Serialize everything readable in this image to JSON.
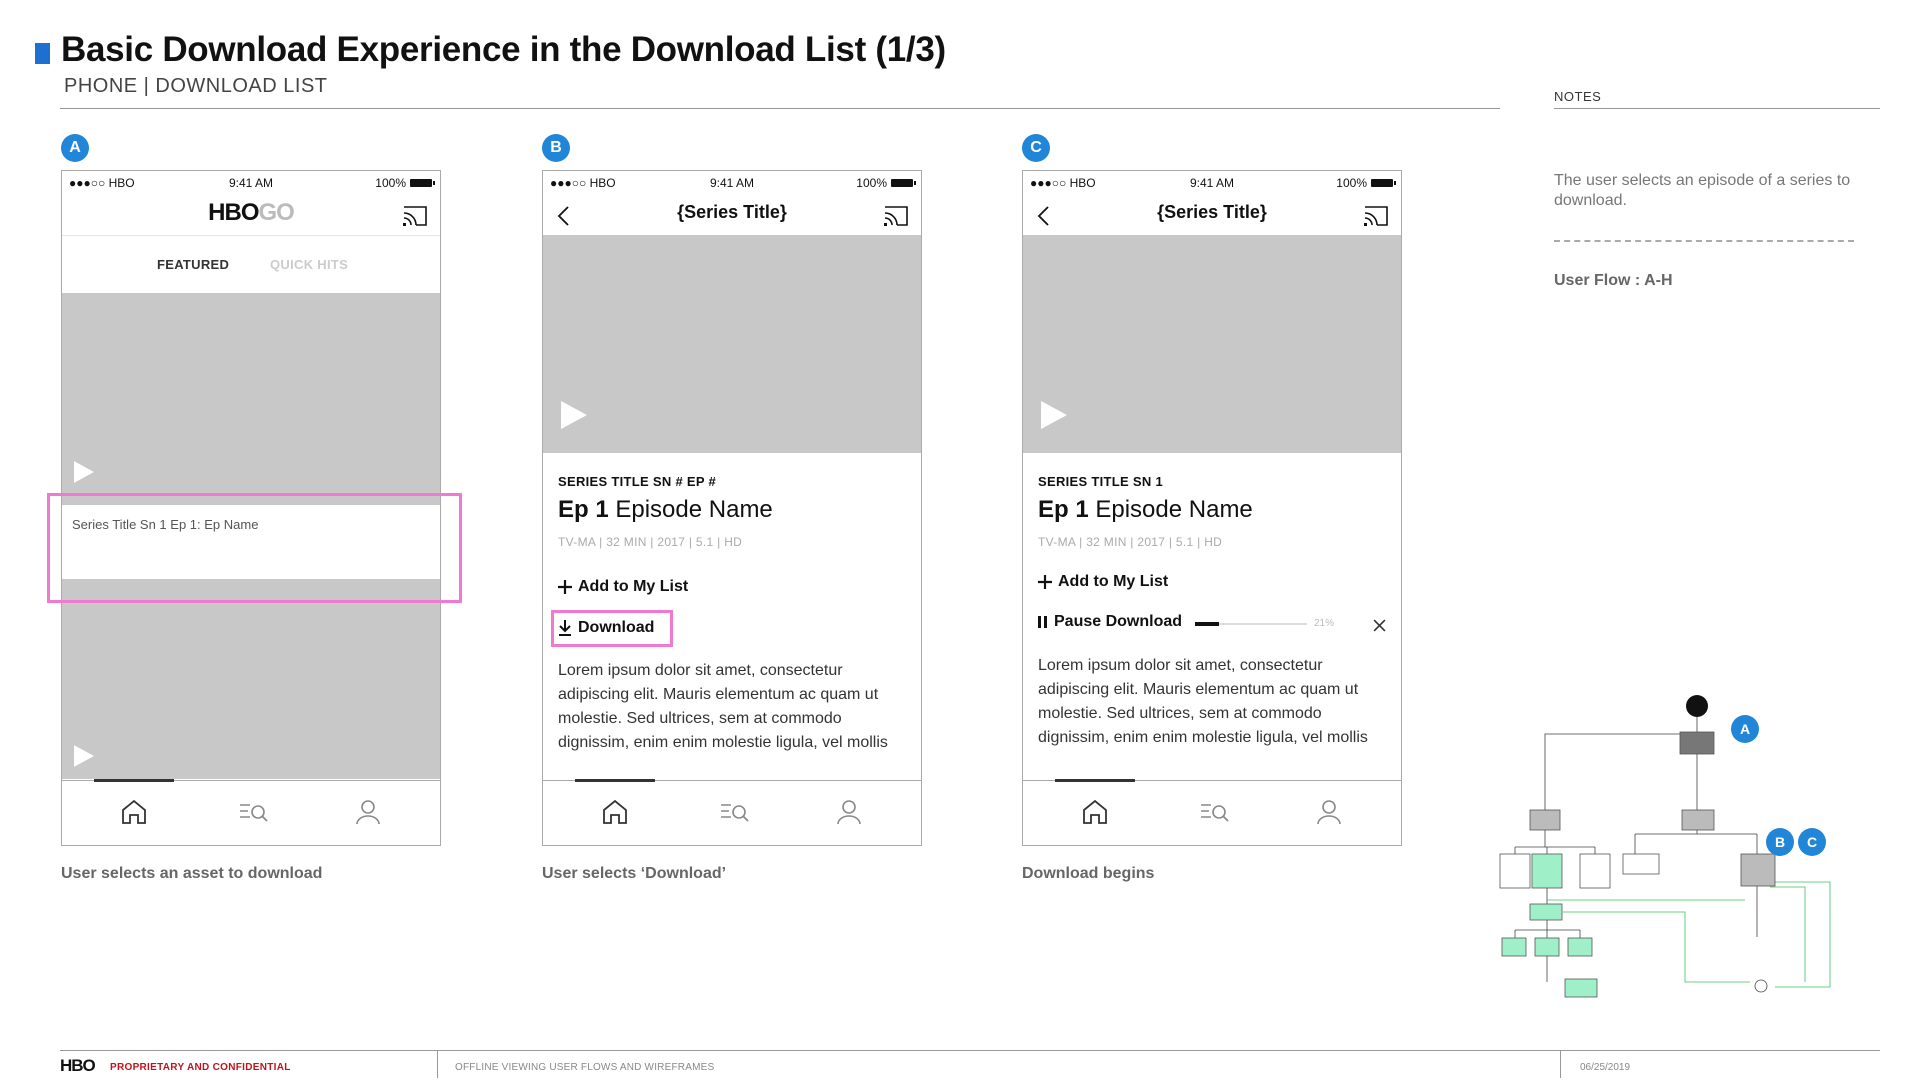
{
  "header": {
    "title": "Basic Download Experience in the Download List (1/3)",
    "subtitle": "PHONE | DOWNLOAD LIST",
    "accent": "#1d6fd0"
  },
  "notes": {
    "label": "NOTES",
    "text": "The user selects an episode of a series to download.",
    "user_flow": "User Flow : A-H"
  },
  "status_bar": {
    "carrier": "●●●○○ HBO",
    "time": "9:41 AM",
    "battery": "100%"
  },
  "screen_a": {
    "marker": "A",
    "logo_hbo": "HBO",
    "logo_go": "GO",
    "tab_featured": "FEATURED",
    "tab_quick_hits": "QUICK HITS",
    "asset_label": "Series Title Sn 1 Ep 1: Ep Name",
    "caption": "User selects an asset to download"
  },
  "screen_b": {
    "marker": "B",
    "nav_title": "{Series Title}",
    "series_line": "SERIES TITLE SN # EP #",
    "ep_prefix": "Ep 1",
    "ep_name": "Episode Name",
    "meta": "TV-MA | 32 MIN | 2017 | 5.1 | HD",
    "add_to_list": "Add to My List",
    "download": "Download",
    "description": "Lorem ipsum dolor sit amet, consectetur adipiscing elit. Mauris elementum ac quam ut molestie. Sed ultrices, sem at commodo dignissim, enim enim molestie ligula, vel mollis",
    "caption": "User selects ‘Download’"
  },
  "screen_c": {
    "marker": "C",
    "nav_title": "{Series Title}",
    "series_line": "SERIES TITLE SN 1",
    "ep_prefix": "Ep 1",
    "ep_name": "Episode Name",
    "meta": "TV-MA | 32 MIN | 2017 | 5.1 | HD",
    "add_to_list": "Add to My List",
    "pause_download": "Pause Download",
    "progress_label": "21%",
    "progress_value": 0.21,
    "description": "Lorem ipsum dolor sit amet, consectetur adipiscing elit. Mauris elementum ac quam ut molestie. Sed ultrices, sem at commodo dignissim, enim enim molestie ligula, vel mollis",
    "caption": "Download begins"
  },
  "flowchart": {
    "markers": [
      "A",
      "B",
      "C"
    ]
  },
  "footer": {
    "logo": "HBO",
    "confidential": "PROPRIETARY AND CONFIDENTIAL",
    "doc_title": "OFFLINE VIEWING USER FLOWS AND WIREFRAMES",
    "date": "06/25/2019"
  },
  "colors": {
    "highlight": "#f07ad0",
    "marker": "#2186d8",
    "flow_green": "#3cc060",
    "flow_box_green": "#9ff0c8",
    "confidential_red": "#c0141c"
  },
  "icons": [
    "back-chevron-icon",
    "cast-icon",
    "play-icon",
    "plus-icon",
    "download-icon",
    "pause-icon",
    "close-icon",
    "home-icon",
    "search-icon",
    "profile-icon"
  ]
}
